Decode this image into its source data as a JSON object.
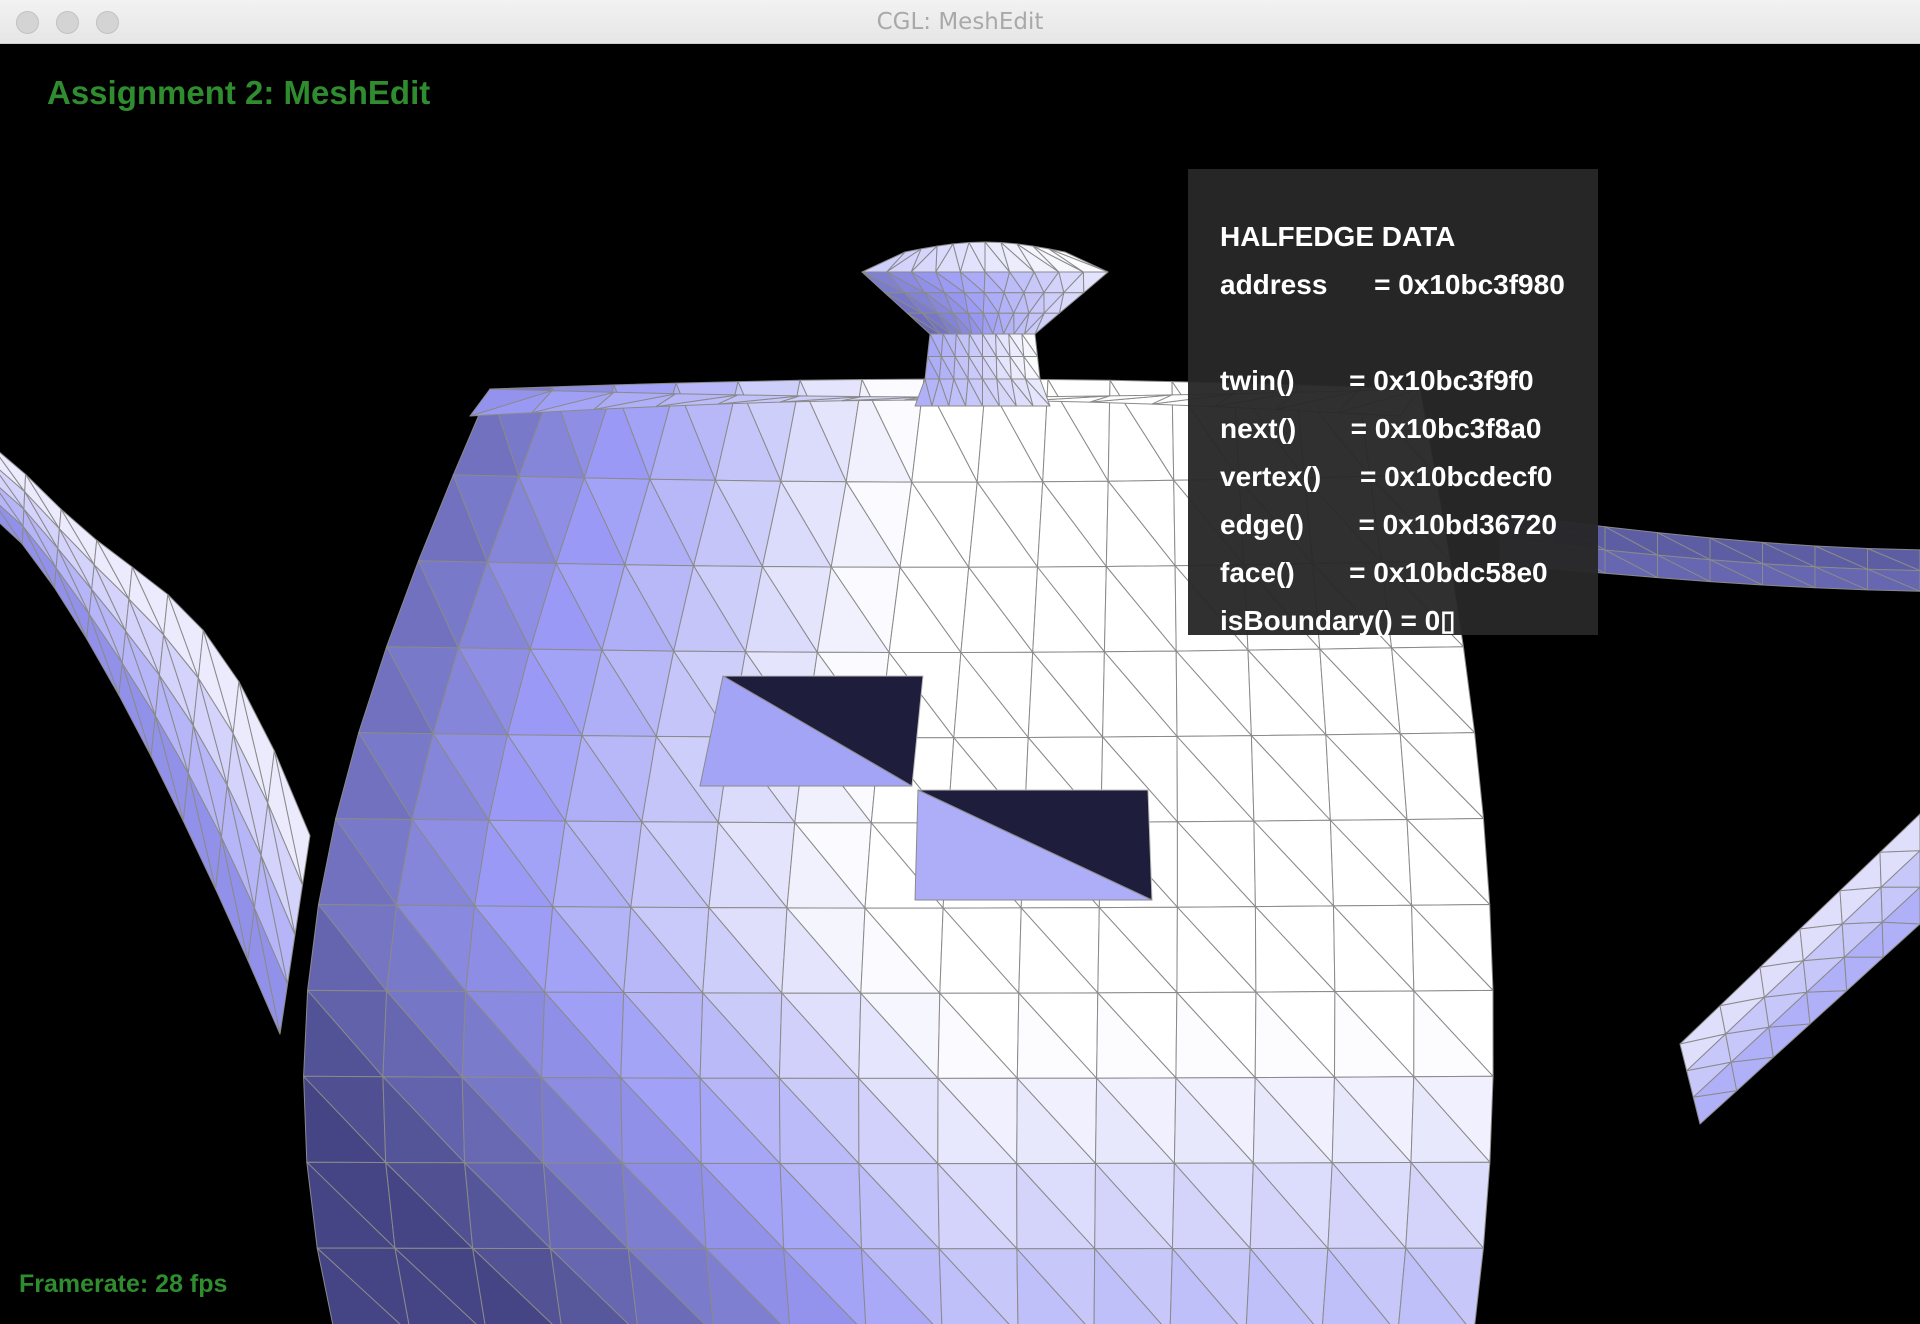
{
  "window": {
    "title": "CGL: MeshEdit"
  },
  "overlay": {
    "assignment_title": "Assignment 2: MeshEdit",
    "framerate": "Framerate: 28 fps"
  },
  "halfedge_panel": {
    "header": "HALFEDGE DATA",
    "lines": [
      "address      = 0x10bc3f980",
      "",
      "twin()       = 0x10bc3f9f0",
      "next()       = 0x10bc3f8a0",
      "vertex()     = 0x10bcdecf0",
      "edge()       = 0x10bd36720",
      "face()       = 0x10bdc58e0",
      "isBoundary() = 0▯"
    ]
  },
  "colors": {
    "background": "#000000",
    "title_green": "#2f8d2f",
    "panel_bg": "#282828",
    "mesh_light": "#ffffff",
    "mesh_mid": "#b4b4ff",
    "mesh_dark": "#505096",
    "selected_face": "#1e1e3c",
    "wire": "#8a8a8a"
  },
  "scene": {
    "object": "teapot-mesh",
    "selected_element": "halfedge"
  }
}
